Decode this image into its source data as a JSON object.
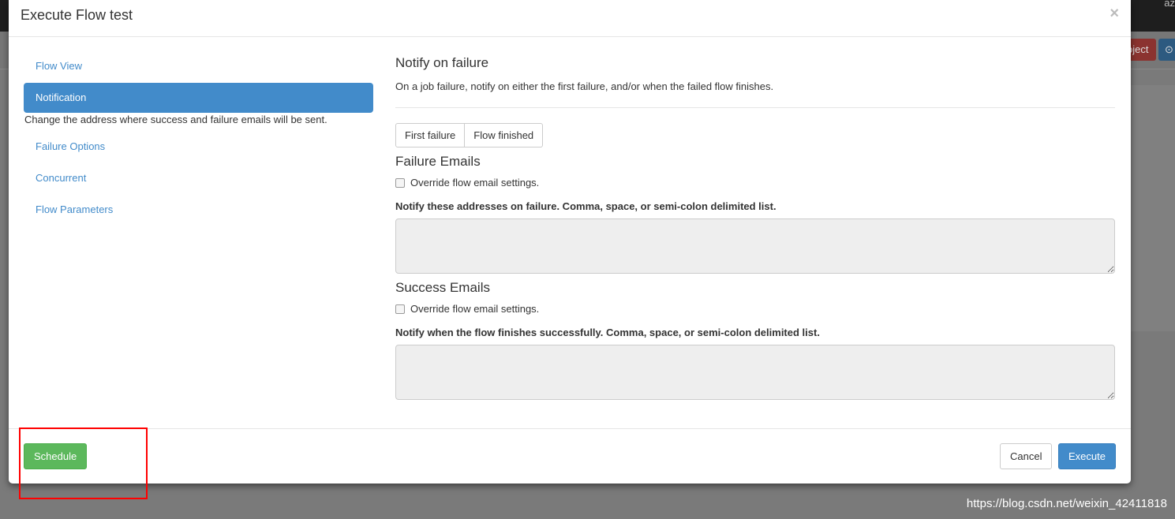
{
  "background": {
    "user": "az",
    "btn_project": "oject",
    "btn_info_icon": "upload-icon"
  },
  "modal": {
    "title": "Execute Flow test",
    "close": "×"
  },
  "nav": {
    "items": [
      {
        "label": "Flow View"
      },
      {
        "label": "Notification",
        "active": true
      },
      {
        "label": "Failure Options"
      },
      {
        "label": "Concurrent"
      },
      {
        "label": "Flow Parameters"
      }
    ],
    "help": "Change the address where success and failure emails will be sent."
  },
  "content": {
    "notify_title": "Notify on failure",
    "notify_desc": "On a job failure, notify on either the first failure, and/or when the failed flow finishes.",
    "options": [
      "First failure",
      "Flow finished"
    ],
    "failure_title": "Failure Emails",
    "failure_override": "Override flow email settings.",
    "failure_label": "Notify these addresses on failure. Comma, space, or semi-colon delimited list.",
    "failure_value": "",
    "success_title": "Success Emails",
    "success_override": "Override flow email settings.",
    "success_label": "Notify when the flow finishes successfully. Comma, space, or semi-colon delimited list.",
    "success_value": ""
  },
  "footer": {
    "schedule": "Schedule",
    "cancel": "Cancel",
    "execute": "Execute"
  },
  "colors": {
    "primary": "#428bca",
    "success": "#5cb85c",
    "highlight": "#ff0000"
  },
  "watermark": "https://blog.csdn.net/weixin_42411818"
}
